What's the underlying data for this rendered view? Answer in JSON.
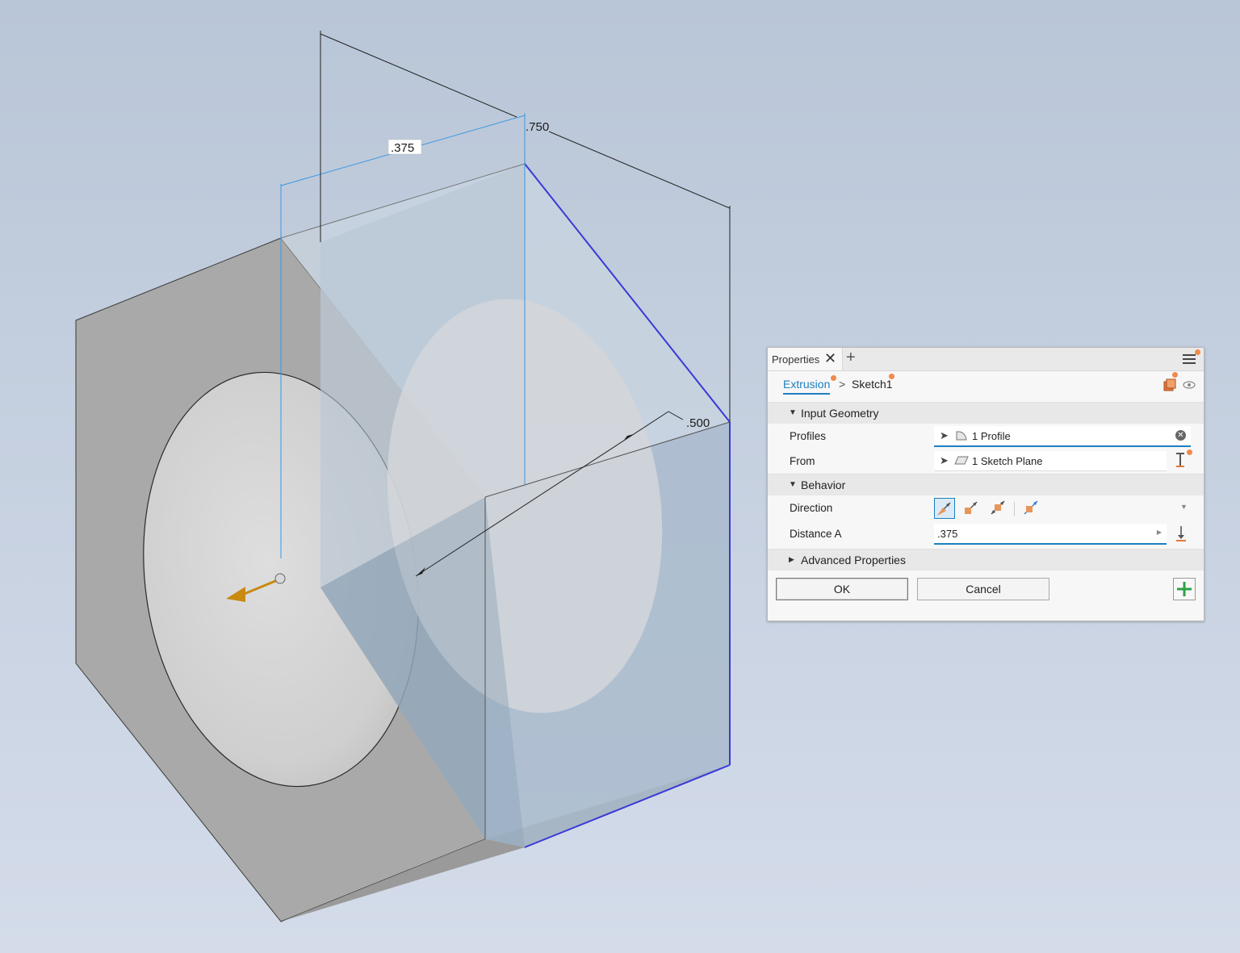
{
  "dimensions": {
    "d1": ".375",
    "d2": ".750",
    "d3": ".500"
  },
  "panel": {
    "tab_label": "Properties",
    "breadcrumb": {
      "feature": "Extrusion",
      "separator": ">",
      "sketch": "Sketch1"
    },
    "sections": {
      "input_geometry": "Input Geometry",
      "behavior": "Behavior",
      "advanced": "Advanced Properties"
    },
    "rows": {
      "profiles_label": "Profiles",
      "profiles_value": "1 Profile",
      "from_label": "From",
      "from_value": "1 Sketch Plane",
      "direction_label": "Direction",
      "distance_label": "Distance A",
      "distance_value": ".375"
    },
    "buttons": {
      "ok": "OK",
      "cancel": "Cancel"
    },
    "colors": {
      "accent": "#1d7fc0",
      "badge": "#f08a4b",
      "add_green": "#2ea043"
    }
  }
}
